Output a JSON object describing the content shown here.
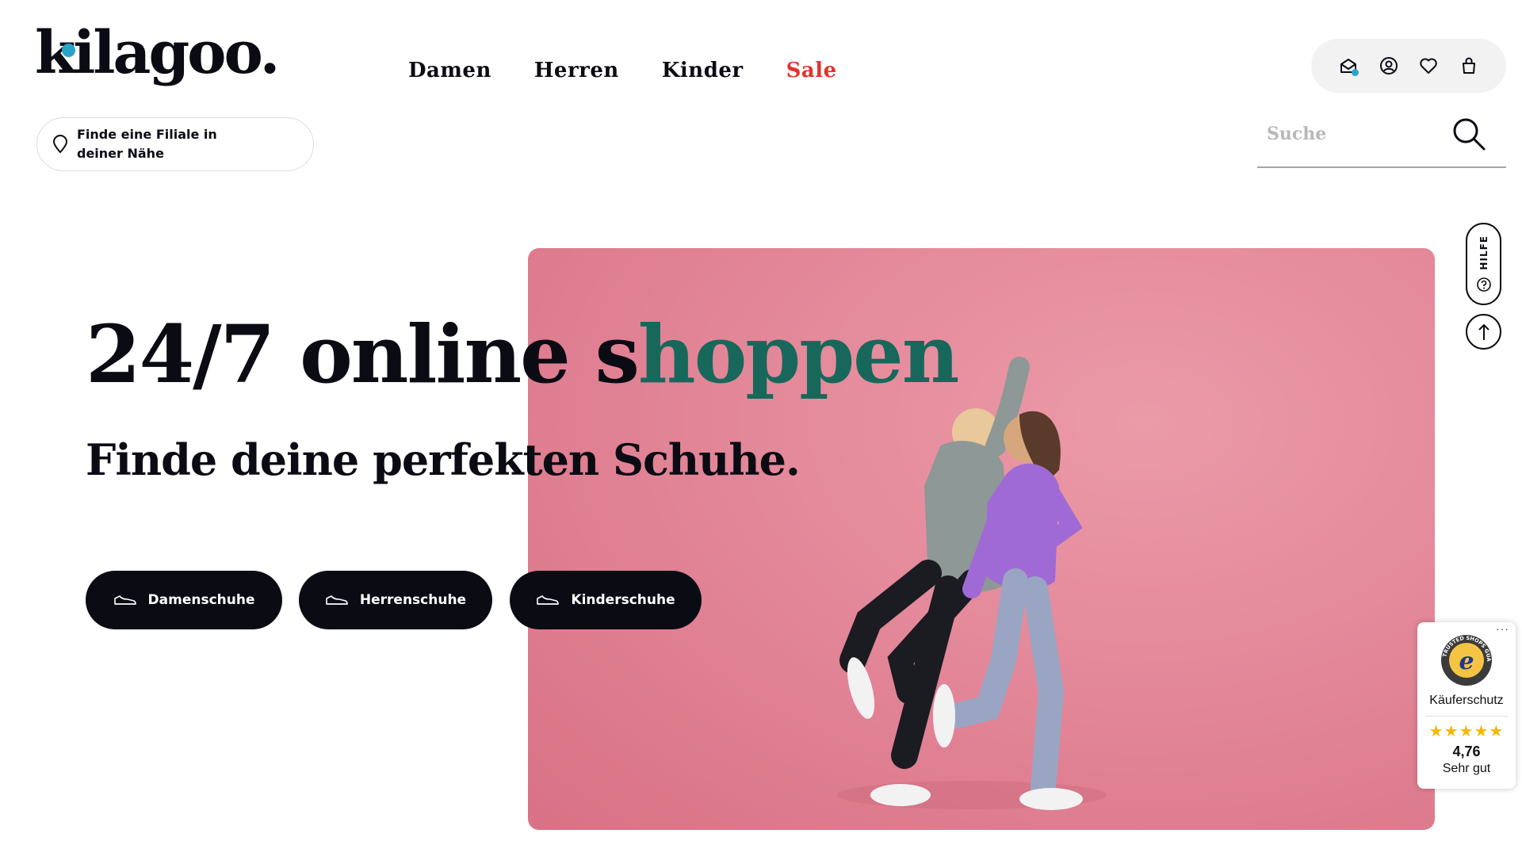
{
  "brand": {
    "logo_text": "kilagoo.",
    "accent_dot_color": "#2aa3c9"
  },
  "nav": {
    "items": [
      {
        "label": "Damen"
      },
      {
        "label": "Herren"
      },
      {
        "label": "Kinder"
      },
      {
        "label": "Sale",
        "color": "#e3342f"
      }
    ]
  },
  "store_finder": {
    "label": "Finde eine Filiale in deiner Nähe",
    "icon": "map-pin-icon"
  },
  "header_icons": [
    "mail-icon",
    "user-icon",
    "heart-icon",
    "bag-icon"
  ],
  "search": {
    "placeholder": "Suche",
    "icon": "search-icon"
  },
  "hero": {
    "headline_lead": "24/7 online s",
    "headline_accent": "hoppen",
    "headline_accent_color": "#17685b",
    "subline": "Finde deine perfekten Schuhe.",
    "image_description_color": "#e48a9b",
    "buttons": [
      {
        "label": "Damenschuhe",
        "icon": "shoe-icon"
      },
      {
        "label": "Herrenschuhe",
        "icon": "shoe-icon"
      },
      {
        "label": "Kinderschuhe",
        "icon": "shoe-icon"
      }
    ]
  },
  "side": {
    "help_label": "HILFE",
    "help_icon": "question-icon",
    "top_icon": "arrow-up-icon"
  },
  "trusted_shops": {
    "more": "···",
    "seal_text": "TRUSTED SHOPS GUARANTEE",
    "seal_letter": "e",
    "protection": "Käuferschutz",
    "stars": "★★★★★",
    "rating": "4,76",
    "verdict": "Sehr gut"
  }
}
